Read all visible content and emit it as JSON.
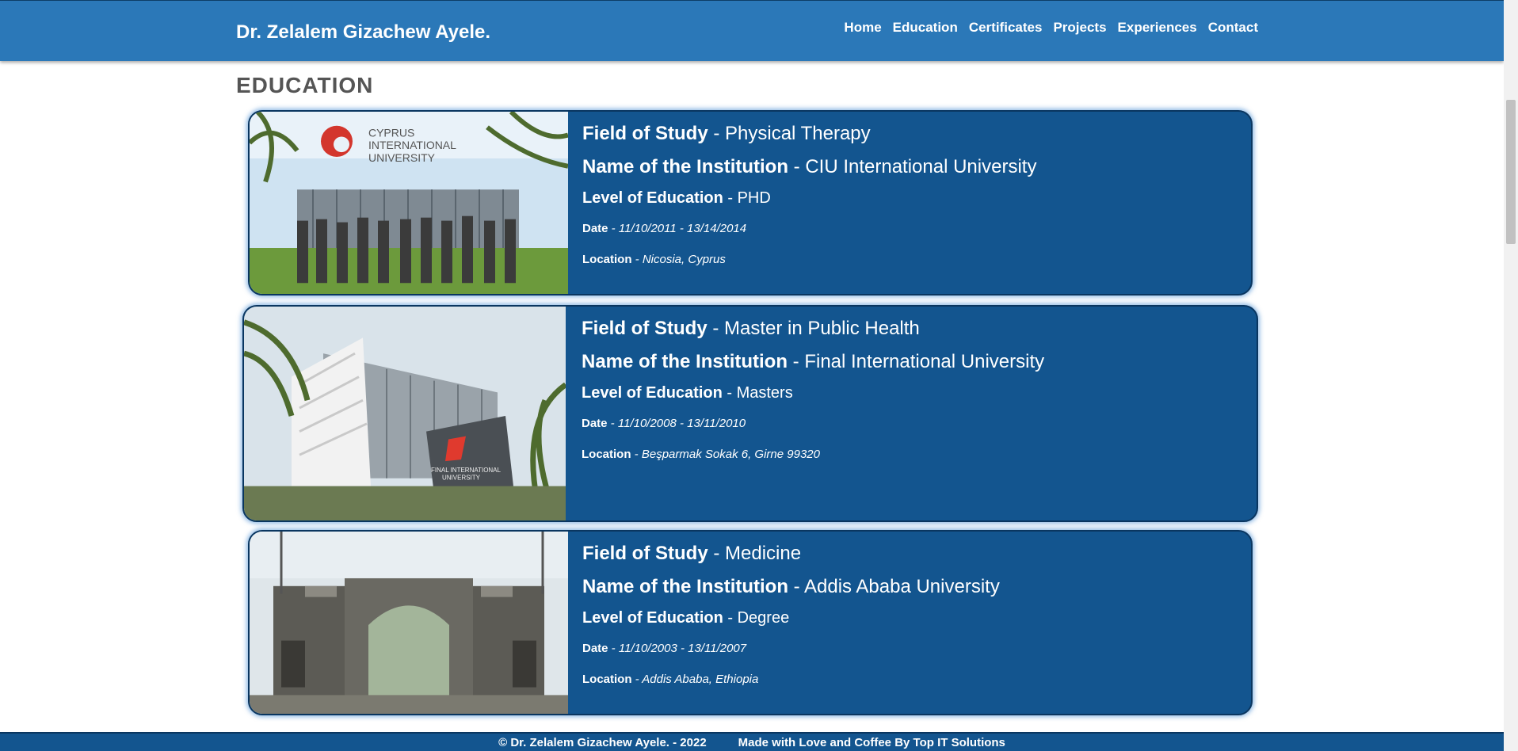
{
  "header": {
    "brand": "Dr. Zelalem Gizachew Ayele.",
    "nav": [
      "Home",
      "Education",
      "Certificates",
      "Projects",
      "Experiences",
      "Contact"
    ]
  },
  "section": {
    "title": "EDUCATION"
  },
  "labels": {
    "field": "Field of Study",
    "institution": "Name of the Institution",
    "level": "Level of Education",
    "date": "Date",
    "location": "Location"
  },
  "education": [
    {
      "field": "Physical Therapy",
      "institution": "CIU International University",
      "level": "PHD",
      "date": "11/10/2011 - 13/14/2014",
      "location": "Nicosia, Cyprus",
      "image_text": [
        "CYPRUS",
        "INTERNATIONAL",
        "UNIVERSITY"
      ]
    },
    {
      "field": "Master in Public Health",
      "institution": "Final International University",
      "level": "Masters",
      "date": "11/10/2008 - 13/11/2010",
      "location": "Beşparmak Sokak 6, Girne 99320",
      "image_text": [
        "FINAL INTERNATIONAL",
        "UNIVERSITY"
      ]
    },
    {
      "field": "Medicine",
      "institution": "Addis Ababa University",
      "level": "Degree",
      "date": "11/10/2003 - 13/11/2007",
      "location": "Addis Ababa, Ethiopia"
    }
  ],
  "footer": {
    "copyright": "© Dr. Zelalem Gizachew Ayele. - 2022",
    "credit": "Made with Love and Coffee By Top IT Solutions"
  },
  "colors": {
    "navbar": "#2b78b8",
    "card": "#13558f",
    "footer": "#13558f"
  }
}
